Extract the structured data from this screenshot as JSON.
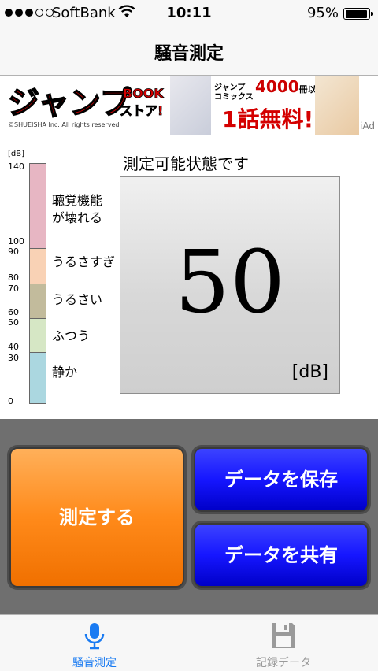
{
  "status_bar": {
    "signal_bars": 5,
    "signal_filled": 3,
    "carrier": "SoftBank",
    "time": "10:11",
    "battery_pct": "95%",
    "battery_level": 0.95
  },
  "nav": {
    "title": "騒音測定"
  },
  "ad": {
    "brand": "ジャンプ BOOKストア!",
    "copyright": "©SHUEISHA Inc. All rights reserved",
    "headline1": "ジャンプ",
    "count": "4000",
    "headline1_suffix": "冊以上!",
    "headline2": "コミックス",
    "free": "1話無料!!!",
    "iad": "iAd",
    "colors": {
      "brand_red": "#d40000"
    }
  },
  "scale": {
    "unit": "[dB]",
    "ticks": [
      "140",
      "100",
      "90",
      "80",
      "70",
      "60",
      "50",
      "40",
      "30",
      "0"
    ],
    "levels": [
      {
        "label_lines": [
          "聴覚機能",
          "が壊れる"
        ],
        "from_db": 100,
        "to_db": 140,
        "color": "#e7b6c3"
      },
      {
        "label_lines": [
          "うるさすぎ"
        ],
        "from_db": 80,
        "to_db": 90,
        "color": "#f9d2b5"
      },
      {
        "label_lines": [
          "うるさい"
        ],
        "from_db": 60,
        "to_db": 70,
        "color": "#c2bb9c"
      },
      {
        "label_lines": [
          "ふつう"
        ],
        "from_db": 40,
        "to_db": 50,
        "color": "#d6e7c5"
      },
      {
        "label_lines": [
          "静か"
        ],
        "from_db": 0,
        "to_db": 30,
        "color": "#abd7e0"
      }
    ]
  },
  "meter": {
    "state_text": "測定可能状態です",
    "value": "50",
    "unit": "[dB]"
  },
  "actions": {
    "measure": "測定する",
    "save": "データを保存",
    "share": "データを共有"
  },
  "tabs": [
    {
      "label": "騒音測定",
      "icon": "microphone-icon",
      "active": true
    },
    {
      "label": "記録データ",
      "icon": "floppy-disk-icon",
      "active": false
    }
  ],
  "colors": {
    "tab_active": "#1a7bf2",
    "measure_button": "#ff8a1a",
    "data_buttons": "#1616ff"
  }
}
